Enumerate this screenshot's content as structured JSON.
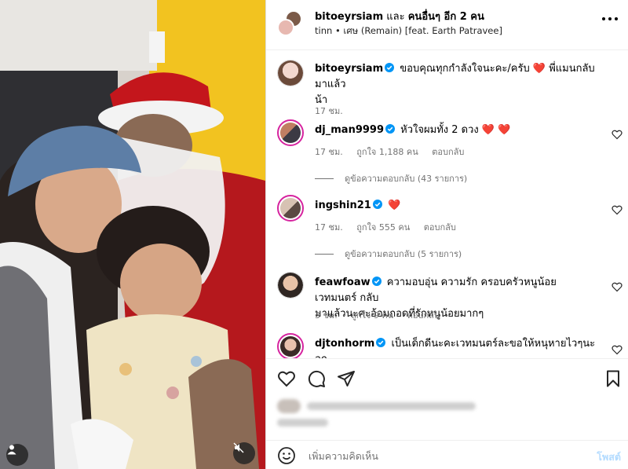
{
  "header": {
    "username": "bitoeyrsiam",
    "connector": "และ",
    "others": "คนอื่นๆ อีก 2 คน",
    "audio_artist": "tinn",
    "audio_sep": "•",
    "audio_track": "เศษ (Remain) [feat. Earth Patravee]",
    "more_icon": "more-horizontal-icon"
  },
  "caption": {
    "username": "bitoeyrsiam",
    "text": "ขอบคุณทุกกำลังใจนะคะ/ครับ",
    "emoji": "❤️",
    "text2": "พี่แมนกลับมาแล้ว",
    "text3": "น้า",
    "time": "17 ชม."
  },
  "comments": [
    {
      "username": "dj_man9999",
      "text": "หัวใจผมทั้ง 2 ดวง",
      "emoji": "❤️ ❤️",
      "time": "17 ชม.",
      "likes": "ถูกใจ 1,188 คน",
      "reply": "ตอบกลับ",
      "view_replies": "ดูข้อความตอบกลับ (43 รายการ)"
    },
    {
      "username": "ingshin21",
      "text": "",
      "emoji": "❤️",
      "time": "17 ชม.",
      "likes": "ถูกใจ 555 คน",
      "reply": "ตอบกลับ",
      "view_replies": "ดูข้อความตอบกลับ (5 รายการ)"
    },
    {
      "username": "feawfoaw",
      "text": "ความอบอุ่น ความรัก ครอบครัวหนูน้อยเวทมนตร์ กลับ",
      "text2": "มาแล้วนะคะอ้อมกอดที่รักหนูน้อยมากๆ",
      "time": "3 ชม.",
      "likes": "ถูกใจ 9 คน",
      "reply": "ตอบกลับ"
    },
    {
      "username": "djtonhorm",
      "text": "เป็นเด็กดีนะคะเวทมนตร์ละขอให้หนุหายไวๆนะลูก"
    }
  ],
  "actions": {
    "like_icon": "heart-icon",
    "comment_icon": "comment-icon",
    "share_icon": "send-icon",
    "save_icon": "bookmark-icon"
  },
  "add_comment": {
    "placeholder": "เพิ่มความคิดเห็น",
    "post_label": "โพสต์",
    "emoji_icon": "smiley-icon"
  },
  "colors": {
    "verified": "#0095f6",
    "heart": "#ff3040",
    "post_disabled": "#b3dbff",
    "story_ring": "#d6249f"
  }
}
